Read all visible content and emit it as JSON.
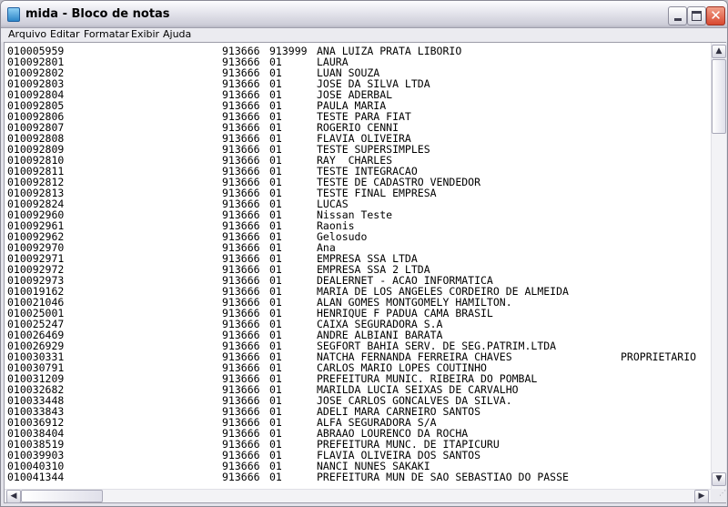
{
  "window": {
    "title": "mida - Bloco de notas",
    "minimize": "minimize",
    "maximize": "maximize",
    "close": "✕"
  },
  "menu": [
    "Arquivo",
    "Editar",
    "Formatar",
    "Exibir",
    "Ajuda"
  ],
  "scrollbars": {
    "vertical_position_percent": 0,
    "horizontal_position_percent": 0
  },
  "rows": [
    [
      "010005959",
      "913666",
      "913999",
      "ANA LUIZA PRATA LIBORIO",
      ""
    ],
    [
      "010092801",
      "913666",
      "01",
      "LAURA",
      ""
    ],
    [
      "010092802",
      "913666",
      "01",
      "LUAN SOUZA",
      ""
    ],
    [
      "010092803",
      "913666",
      "01",
      "JOSE DA SILVA LTDA",
      ""
    ],
    [
      "010092804",
      "913666",
      "01",
      "JOSE ADERBAL",
      ""
    ],
    [
      "010092805",
      "913666",
      "01",
      "PAULA MARIA",
      ""
    ],
    [
      "010092806",
      "913666",
      "01",
      "TESTE PARA FIAT",
      ""
    ],
    [
      "010092807",
      "913666",
      "01",
      "ROGERIO CENNI",
      ""
    ],
    [
      "010092808",
      "913666",
      "01",
      "FLAVIA OLIVEIRA",
      ""
    ],
    [
      "010092809",
      "913666",
      "01",
      "TESTE SUPERSIMPLES",
      ""
    ],
    [
      "010092810",
      "913666",
      "01",
      "RAY  CHARLES",
      ""
    ],
    [
      "010092811",
      "913666",
      "01",
      "TESTE INTEGRACAO",
      ""
    ],
    [
      "010092812",
      "913666",
      "01",
      "TESTE DE CADASTRO VENDEDOR",
      ""
    ],
    [
      "010092813",
      "913666",
      "01",
      "TESTE FINAL EMPRESA",
      ""
    ],
    [
      "010092824",
      "913666",
      "01",
      "LUCAS",
      ""
    ],
    [
      "010092960",
      "913666",
      "01",
      "Nissan Teste",
      ""
    ],
    [
      "010092961",
      "913666",
      "01",
      "Raonis",
      ""
    ],
    [
      "010092962",
      "913666",
      "01",
      "Gelosudo",
      ""
    ],
    [
      "010092970",
      "913666",
      "01",
      "Ana",
      ""
    ],
    [
      "010092971",
      "913666",
      "01",
      "EMPRESA SSA LTDA",
      ""
    ],
    [
      "010092972",
      "913666",
      "01",
      "EMPRESA SSA 2 LTDA",
      ""
    ],
    [
      "010092973",
      "913666",
      "01",
      "DEALERNET - ACAO INFORMATICA",
      ""
    ],
    [
      "010019162",
      "913666",
      "01",
      "MARIA DE LOS ANGELES CORDEIRO DE ALMEIDA",
      ""
    ],
    [
      "010021046",
      "913666",
      "01",
      "ALAN GOMES MONTGOMELY HAMILTON.",
      ""
    ],
    [
      "010025001",
      "913666",
      "01",
      "HENRIQUE F PADUA CAMA BRASIL",
      ""
    ],
    [
      "010025247",
      "913666",
      "01",
      "CAIXA SEGURADORA S.A",
      ""
    ],
    [
      "010026469",
      "913666",
      "01",
      "ANDRE ALBIANI BARATA",
      ""
    ],
    [
      "010026929",
      "913666",
      "01",
      "SEGFORT BAHIA SERV. DE SEG.PATRIM.LTDA",
      ""
    ],
    [
      "010030331",
      "913666",
      "01",
      "NATCHA FERNANDA FERREIRA CHAVES",
      "PROPRIETARIO"
    ],
    [
      "010030791",
      "913666",
      "01",
      "CARLOS MARIO LOPES COUTINHO",
      ""
    ],
    [
      "010031209",
      "913666",
      "01",
      "PREFEITURA MUNIC. RIBEIRA DO POMBAL",
      ""
    ],
    [
      "010032682",
      "913666",
      "01",
      "MARILDA LUCIA SEIXAS DE CARVALHO",
      ""
    ],
    [
      "010033448",
      "913666",
      "01",
      "JOSE CARLOS GONCALVES DA SILVA.",
      ""
    ],
    [
      "010033843",
      "913666",
      "01",
      "ADELI MARA CARNEIRO SANTOS",
      ""
    ],
    [
      "010036912",
      "913666",
      "01",
      "ALFA SEGURADORA S/A",
      ""
    ],
    [
      "010038404",
      "913666",
      "01",
      "ABRAAO LOURENCO DA ROCHA",
      ""
    ],
    [
      "010038519",
      "913666",
      "01",
      "PREFEITURA MUNC. DE ITAPICURU",
      ""
    ],
    [
      "010039903",
      "913666",
      "01",
      "FLAVIA OLIVEIRA DOS SANTOS",
      ""
    ],
    [
      "010040310",
      "913666",
      "01",
      "NANCI NUNES SAKAKI",
      ""
    ],
    [
      "010041344",
      "913666",
      "01",
      "PREFEITURA MUN DE SAO SEBASTIAO DO PASSE",
      ""
    ]
  ]
}
